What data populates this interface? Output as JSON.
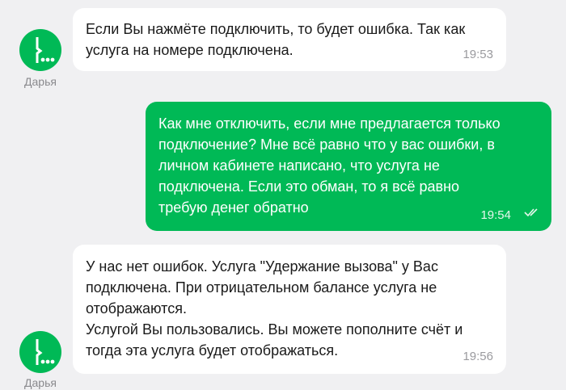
{
  "agent_name": "Дарья",
  "colors": {
    "brand": "#00b956",
    "background": "#f0f0f2",
    "bubble_in": "#ffffff"
  },
  "messages": [
    {
      "side": "in",
      "lines": [
        "Если Вы нажмёте подключить, то будет ошибка. Так как",
        "услуга на номере подключена."
      ],
      "time": "19:53"
    },
    {
      "side": "out",
      "lines": [
        "Как мне отключить, если мне предлагается только",
        "подключение? Мне всё равно что у вас ошибки, в",
        "личном кабинете написано, что услуга не",
        "подключена. Если это обман, то я всё равно",
        "требую денег обратно"
      ],
      "time": "19:54",
      "status_icon": "double-check-icon"
    },
    {
      "side": "in",
      "lines": [
        "У нас нет ошибок. Услуга \"Удержание вызова\" у Вас",
        "подключена. При отрицательном балансе услуга не",
        "отображаются.",
        "Услугой Вы пользовались. Вы можете пополните счёт и",
        "тогда эта услуга будет отображаться."
      ],
      "time": "19:56"
    }
  ]
}
